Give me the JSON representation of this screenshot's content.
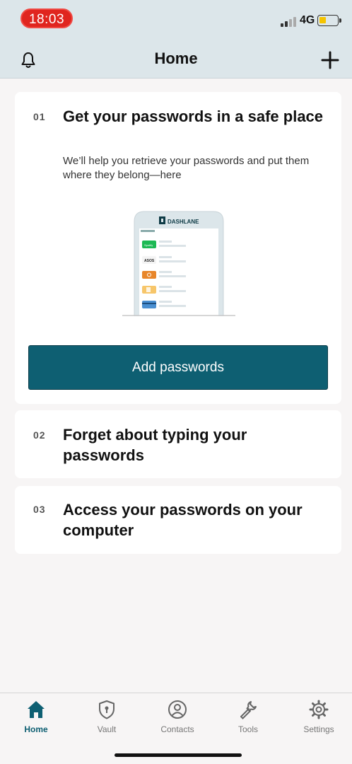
{
  "status_bar": {
    "time": "18:03",
    "network": "4G"
  },
  "header": {
    "title": "Home",
    "left_icon": "bell-icon",
    "right_icon": "plus-icon"
  },
  "steps": [
    {
      "number": "01",
      "title": "Get your passwords in a safe place",
      "description": "We’ll help you retrieve your passwords and put them where they belong—here",
      "button_label": "Add passwords"
    },
    {
      "number": "02",
      "title": "Forget about typing your passwords"
    },
    {
      "number": "03",
      "title": "Access your passwords on your computer"
    }
  ],
  "illustration": {
    "brand": "DASHLANE",
    "items": [
      "Spotify",
      "ASOS"
    ]
  },
  "tabbar": [
    {
      "label": "Home",
      "icon": "home-icon",
      "active": true
    },
    {
      "label": "Vault",
      "icon": "shield-icon",
      "active": false
    },
    {
      "label": "Contacts",
      "icon": "contact-icon",
      "active": false
    },
    {
      "label": "Tools",
      "icon": "wrench-icon",
      "active": false
    },
    {
      "label": "Settings",
      "icon": "gear-icon",
      "active": false
    }
  ],
  "colors": {
    "accent": "#0e5f72",
    "header_bg": "#dce6ea",
    "time_pill": "#e0251f"
  }
}
